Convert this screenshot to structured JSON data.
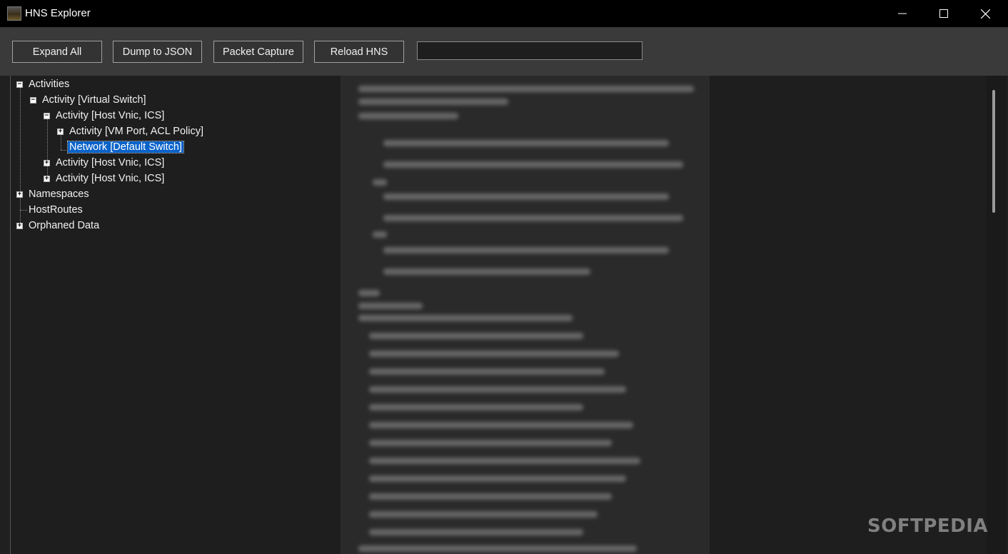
{
  "window": {
    "title": "HNS Explorer",
    "controls": {
      "minimize": "minimize-icon",
      "maximize": "maximize-icon",
      "close": "close-icon"
    }
  },
  "toolbar": {
    "expand_all": "Expand All",
    "dump_json": "Dump to JSON",
    "packet_capture": "Packet Capture",
    "reload_hns": "Reload HNS",
    "search_value": ""
  },
  "tree": {
    "activities": "Activities",
    "activity_virtual_switch": "Activity [Virtual Switch]",
    "activity_host_vnic_1": "Activity [Host Vnic, ICS]",
    "activity_vm_port": "Activity [VM Port, ACL Policy]",
    "network_default_switch": "Network [Default Switch]",
    "activity_host_vnic_2": "Activity [Host Vnic, ICS]",
    "activity_host_vnic_3": "Activity [Host Vnic, ICS]",
    "namespaces": "Namespaces",
    "hostroutes": "HostRoutes",
    "orphaned_data": "Orphaned Data"
  },
  "watermark": "SOFTPEDIA",
  "colors": {
    "selection": "#0a63c9",
    "background": "#1e1e1e",
    "toolbar": "#3a3a3a"
  }
}
